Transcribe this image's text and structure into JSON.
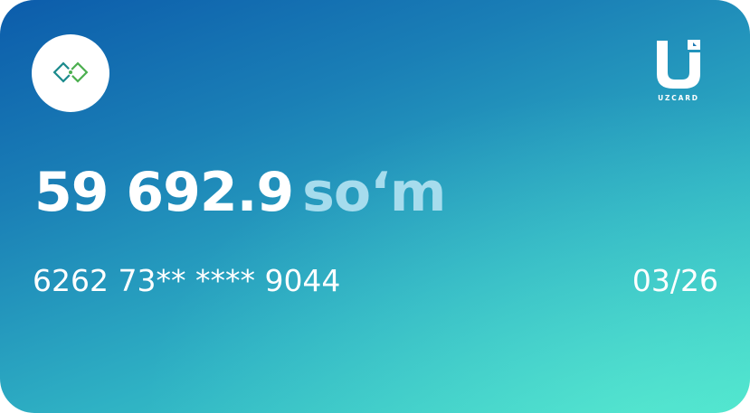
{
  "card": {
    "balance_amount": "59 692.9",
    "currency": "so‘m",
    "masked_number": "6262 73** **** 9044",
    "expiry": "03/26",
    "payment_system": "UZCARD",
    "bank_logo_icon": "bank-diamond-icon",
    "colors": {
      "gradient_start": "#0c5cab",
      "gradient_end": "#48e0cc",
      "currency_text": "#a6dced",
      "logo_green": "#4caf50",
      "logo_teal": "#1b8a8c"
    }
  }
}
